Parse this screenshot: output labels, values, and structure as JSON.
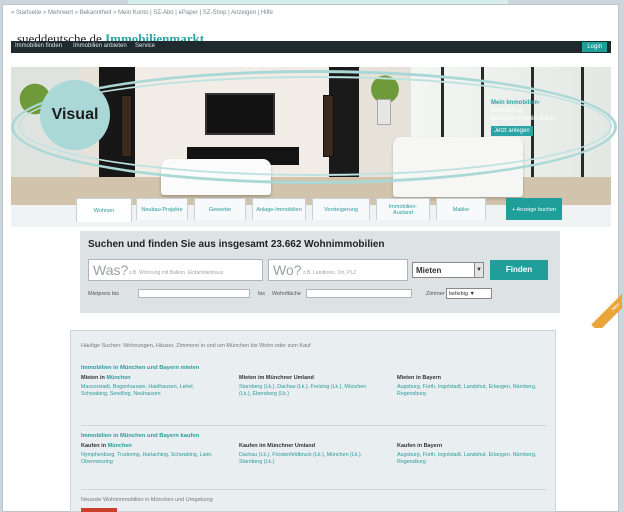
{
  "breadcrumbs": "» Startseite » Mehrwert » Bekanntheit » Mein Konto | SZ-Abo | ePaper | SZ-Shop | Anzeigen | Hilfe",
  "logo": {
    "main": "sueddeutsche.de",
    "accent": "Immobilienmarkt"
  },
  "nav": {
    "items": [
      "Immobilien finden",
      "Immobilien anbieten",
      "Service"
    ],
    "login": "Login"
  },
  "hero": {
    "promo_title": "Mein Immobilien-",
    "promo_text": "Suchauftrag Wunschimmobilie finden",
    "promo_button": "Jetzt anlegen"
  },
  "overlay": {
    "label": "Visual"
  },
  "tabs": [
    {
      "label": "Wohnen",
      "active": true
    },
    {
      "label": "Neubau-Projekte",
      "active": false
    },
    {
      "label": "Gewerbe",
      "active": false
    },
    {
      "label": "Anlage-Immobilien",
      "active": false
    },
    {
      "label": "Versteigerung",
      "active": false
    },
    {
      "label": "Immobilien-Ausland",
      "active": false
    },
    {
      "label": "Makler",
      "active": false
    },
    {
      "label": "+ Anzeige buchen",
      "active": false,
      "cta": true
    }
  ],
  "search": {
    "headline": "Suchen und finden Sie aus insgesamt 23.662 Wohnimmobilien",
    "was_label": "Was?",
    "was_hint": "z.B. Wohnung mit Balkon, Einfamilienhaus",
    "wo_label": "Wo?",
    "wo_hint": "z.B. Landkreis, Ort, PLZ",
    "mode": "Mieten",
    "mode_arrow": "▼",
    "submit": "Finden",
    "price_label": "Mietpreis bis",
    "area_label": "bis",
    "size_label": "Wohnfläche",
    "rooms_label": "Zimmer",
    "rooms_value": "beliebig",
    "select_arrow": "▼"
  },
  "ribbon": "Neu",
  "lower": {
    "intro": "Häufige Suchen: Wohnungen, Häuser, Zimmerei in und um München bis Wohn oder zum Kauf",
    "section1_title": "Immobilien in München und Bayern mieten",
    "section1_cols": [
      {
        "head": "Mieten in",
        "head_link": "München",
        "links": "Maxvorstadt, Bogenhausen, Haidhausen, Lehel, Schwabing, Sendling, Neuhausen"
      },
      {
        "head": "Mieten im Münchner Umland",
        "head_link": "",
        "links": "Starnberg (Lk.), Dachau (Lk.), Freising (Lk.), München (Lk.), Ebersberg (Lk.)"
      },
      {
        "head": "Mieten in Bayern",
        "head_link": "",
        "links": "Augsburg, Fürth, Ingolstadt, Landshut, Erlangen, Nürnberg, Regensburg"
      }
    ],
    "section2_title": "Immobilien in München und Bayern kaufen",
    "section2_cols": [
      {
        "head": "Kaufen in",
        "head_link": "München",
        "links": "Nymphenburg, Trudering, Harlaching, Schwabing, Laim, Obermenzing"
      },
      {
        "head": "Kaufen im Münchner Umland",
        "head_link": "",
        "links": "Dachau (Lk.), Fürstenfeldbruck (Lk.), München (Lk.), Starnberg (Lk.)"
      },
      {
        "head": "Kaufen in Bayern",
        "head_link": "",
        "links": "Augsburg, Fürth, Ingolstadt, Landshut, Erlangen, Nürnberg, Regensburg"
      }
    ],
    "footer": "Neueste Wohnimmobilien in München und Umgebung"
  }
}
